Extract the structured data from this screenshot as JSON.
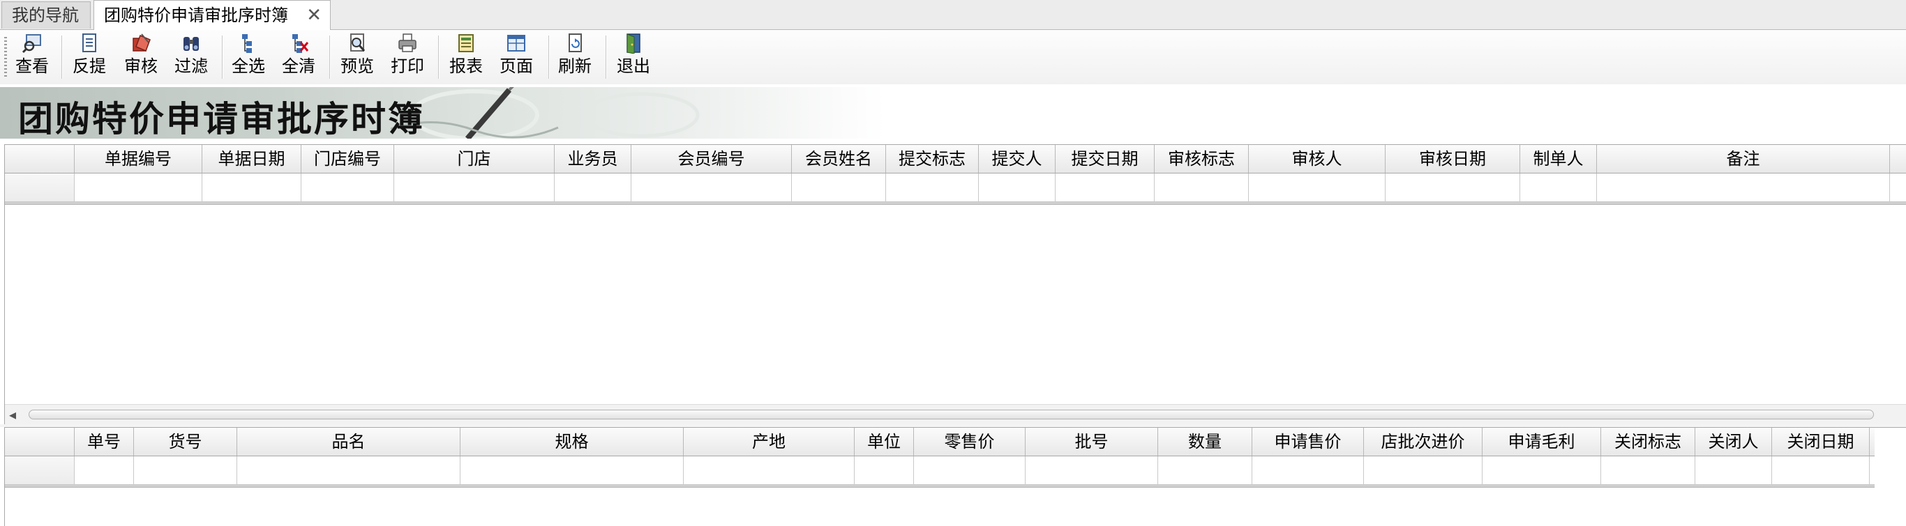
{
  "tabs": {
    "nav": "我的导航",
    "active": "团购特价申请审批序时簿",
    "close": "✕"
  },
  "toolbar": {
    "buttons": [
      {
        "label": "查看",
        "icon": "view-icon"
      },
      {
        "label": "反提",
        "icon": "unsubmit-icon"
      },
      {
        "label": "审核",
        "icon": "approve-icon"
      },
      {
        "label": "过滤",
        "icon": "filter-binoculars-icon"
      },
      {
        "label": "全选",
        "icon": "select-all-icon"
      },
      {
        "label": "全清",
        "icon": "clear-all-icon"
      },
      {
        "label": "预览",
        "icon": "print-preview-icon"
      },
      {
        "label": "打印",
        "icon": "printer-icon"
      },
      {
        "label": "报表",
        "icon": "report-icon"
      },
      {
        "label": "页面",
        "icon": "page-setup-icon"
      },
      {
        "label": "刷新",
        "icon": "refresh-icon"
      },
      {
        "label": "退出",
        "icon": "exit-door-icon"
      }
    ]
  },
  "banner": {
    "title": "团购特价申请审批序时簿"
  },
  "master_grid": {
    "columns": [
      "单据编号",
      "单据日期",
      "门店编号",
      "门店",
      "业务员",
      "会员编号",
      "会员姓名",
      "提交标志",
      "提交人",
      "提交日期",
      "审核标志",
      "审核人",
      "审核日期",
      "制单人",
      "备注"
    ]
  },
  "detail_grid": {
    "columns": [
      "单号",
      "货号",
      "品名",
      "规格",
      "产地",
      "单位",
      "零售价",
      "批号",
      "数量",
      "申请售价",
      "店批次进价",
      "申请毛利",
      "关闭标志",
      "关闭人",
      "关闭日期"
    ]
  }
}
